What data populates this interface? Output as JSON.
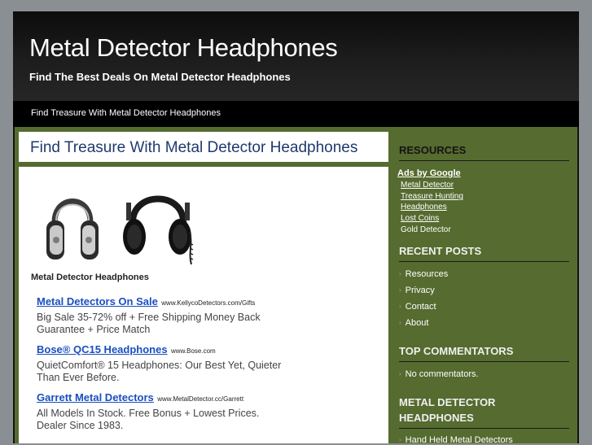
{
  "header": {
    "title": "Metal Detector Headphones",
    "tagline": "Find The Best Deals On Metal Detector Headphones"
  },
  "nav": {
    "link": "Find Treasure With Metal Detector Headphones"
  },
  "post": {
    "title": "Find Treasure With Metal Detector Headphones",
    "caption": "Metal Detector Headphones",
    "ads": [
      {
        "link": "Metal Detectors On Sale",
        "url": "www.KellycoDetectors.com/Gifts",
        "desc": "Big Sale 35-72% off + Free Shipping Money Back Guarantee + Price Match"
      },
      {
        "link": "Bose® QC15 Headphones",
        "url": "www.Bose.com",
        "desc": "QuietComfort® 15 Headphones: Our Best Yet, Quieter Than Ever Before."
      },
      {
        "link": "Garrett Metal Detectors",
        "url": "www.MetalDetector.cc/Garrett",
        "desc": "All Models In Stock. Free Bonus + Lowest Prices. Dealer Since 1983."
      }
    ]
  },
  "sidebar": {
    "resources": {
      "heading": "RESOURCES",
      "ads_label": "Ads by Google",
      "links": [
        "Metal Detector",
        "Treasure Hunting",
        "Headphones",
        "Lost Coins"
      ],
      "plain": "Gold Detector"
    },
    "recent_posts": {
      "heading": "RECENT POSTS",
      "items": [
        "Resources",
        "Privacy",
        "Contact",
        "About"
      ]
    },
    "top_commentators": {
      "heading": "TOP COMMENTATORS",
      "items": [
        "No commentators."
      ]
    },
    "category": {
      "heading_line1": "METAL DETECTOR",
      "heading_line2": "HEADPHONES",
      "items": [
        "Hand Held Metal Detectors"
      ]
    }
  }
}
